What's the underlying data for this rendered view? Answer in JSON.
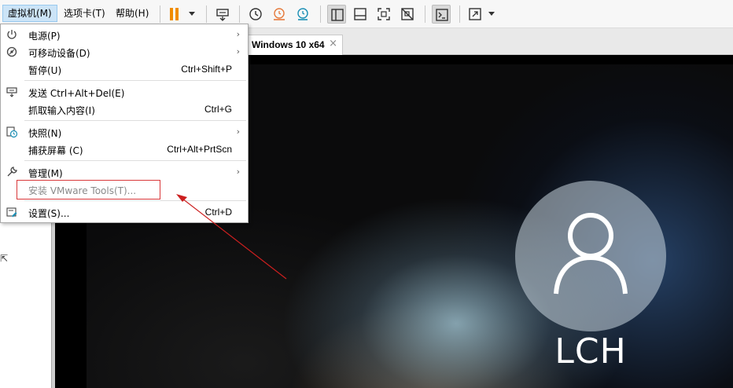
{
  "menubar": {
    "vm": "虚拟机(M)",
    "tabs": "选项卡(T)",
    "help": "帮助(H)"
  },
  "tab": {
    "title": "Windows 10 x64",
    "close": "×"
  },
  "menu": {
    "power": {
      "label": "电源(P)",
      "submenu": "›"
    },
    "removable": {
      "label": "可移动设备(D)",
      "submenu": "›"
    },
    "pause": {
      "label": "暂停(U)",
      "shortcut": "Ctrl+Shift+P"
    },
    "send_cad": {
      "label": "发送 Ctrl+Alt+Del(E)"
    },
    "grab_input": {
      "label": "抓取输入内容(I)",
      "shortcut": "Ctrl+G"
    },
    "snapshot": {
      "label": "快照(N)",
      "submenu": "›"
    },
    "capture": {
      "label": "捕获屏幕 (C)",
      "shortcut": "Ctrl+Alt+PrtScn"
    },
    "manage": {
      "label": "管理(M)",
      "submenu": "›"
    },
    "install_tools": {
      "label": "安装 VMware Tools(T)..."
    },
    "settings": {
      "label": "设置(S)...",
      "shortcut": "Ctrl+D"
    }
  },
  "lockscreen": {
    "username": "LCH"
  },
  "colors": {
    "accent": "#f08c00",
    "highlight_border": "#d9383a",
    "annotation_arrow": "#cc1f1f",
    "menu_active_bg": "#cce4f7"
  }
}
